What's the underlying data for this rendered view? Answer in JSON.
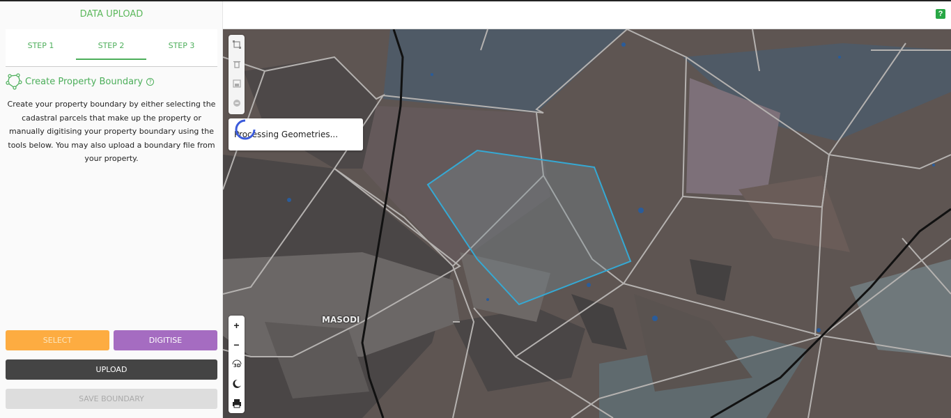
{
  "sidebar": {
    "title": "DATA UPLOAD",
    "tabs": [
      {
        "label": "STEP 1",
        "active": false
      },
      {
        "label": "STEP 2",
        "active": true
      },
      {
        "label": "STEP 3",
        "active": false
      }
    ],
    "section_title": "Create Property Boundary",
    "section_icon": "polygon-icon",
    "help_icon": "question-circle-icon",
    "description": "Create your property boundary by either selecting the cadastral parcels that make up the property or manually digitising your property boundary using the tools below. You may also upload a boundary file from your property.",
    "buttons": {
      "select": "SELECT",
      "digitise": "DIGITISE",
      "upload": "UPLOAD",
      "save_boundary": "SAVE BOUNDARY"
    }
  },
  "header": {
    "help_label": "?"
  },
  "map": {
    "processing_text": "Processing Geometries...",
    "place_label": "MASODI",
    "zoom_in": "+",
    "zoom_out": "−",
    "top_tools": [
      "square-select-icon",
      "trash-icon",
      "save-icon",
      "cancel-icon"
    ],
    "bottom_tools": [
      "zoom-in-icon",
      "zoom-out-icon",
      "3d-icon",
      "night-mode-icon",
      "print-icon"
    ],
    "three_d_label": "3D"
  },
  "colors": {
    "accent_green": "#4cae5a",
    "select_orange": "#fdac41",
    "digitise_purple": "#a56cc1",
    "upload_dark": "#444444",
    "boundary_cyan": "#35a9d4"
  }
}
